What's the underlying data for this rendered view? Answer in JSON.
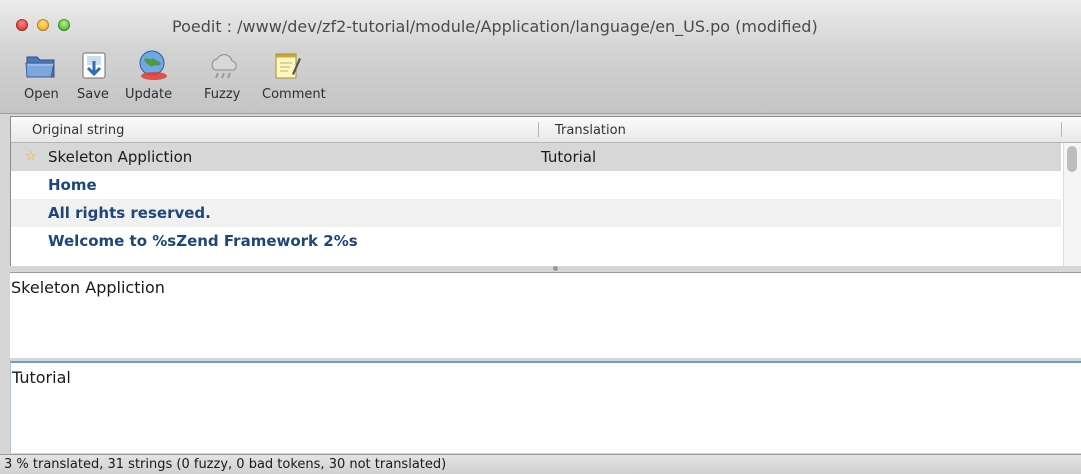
{
  "window": {
    "title": "Poedit : /www/dev/zf2-tutorial/module/Application/language/en_US.po (modified)",
    "controls": [
      "close",
      "minimize",
      "zoom"
    ]
  },
  "toolbar": {
    "open_label": "Open",
    "save_label": "Save",
    "update_label": "Update",
    "fuzzy_label": "Fuzzy",
    "comment_label": "Comment"
  },
  "list": {
    "columns": [
      "Original string",
      "Translation"
    ],
    "rows": [
      {
        "original": "Skeleton Appliction",
        "translation": "Tutorial",
        "selected": true,
        "translated": true
      },
      {
        "original": "Home",
        "translation": "",
        "selected": false,
        "translated": false
      },
      {
        "original": "All rights reserved.",
        "translation": "",
        "selected": false,
        "translated": false
      },
      {
        "original": "Welcome to %sZend Framework 2%s",
        "translation": "",
        "selected": false,
        "translated": false
      }
    ]
  },
  "editor": {
    "source_text": "Skeleton Appliction",
    "translation_text": "Tutorial"
  },
  "status": {
    "text": "3 % translated, 31 strings (0 fuzzy, 0 bad tokens, 30 not translated)"
  },
  "colors": {
    "untranslated_text": "#1f4678",
    "selection_bg": "#d7d7d7",
    "focus_border": "#6b9bd6"
  },
  "icons": {
    "open": "folder-open-icon",
    "save": "save-icon",
    "update": "update-globe-icon",
    "fuzzy": "fuzzy-cloud-icon",
    "comment": "comment-notepad-icon",
    "star": "star-icon"
  }
}
